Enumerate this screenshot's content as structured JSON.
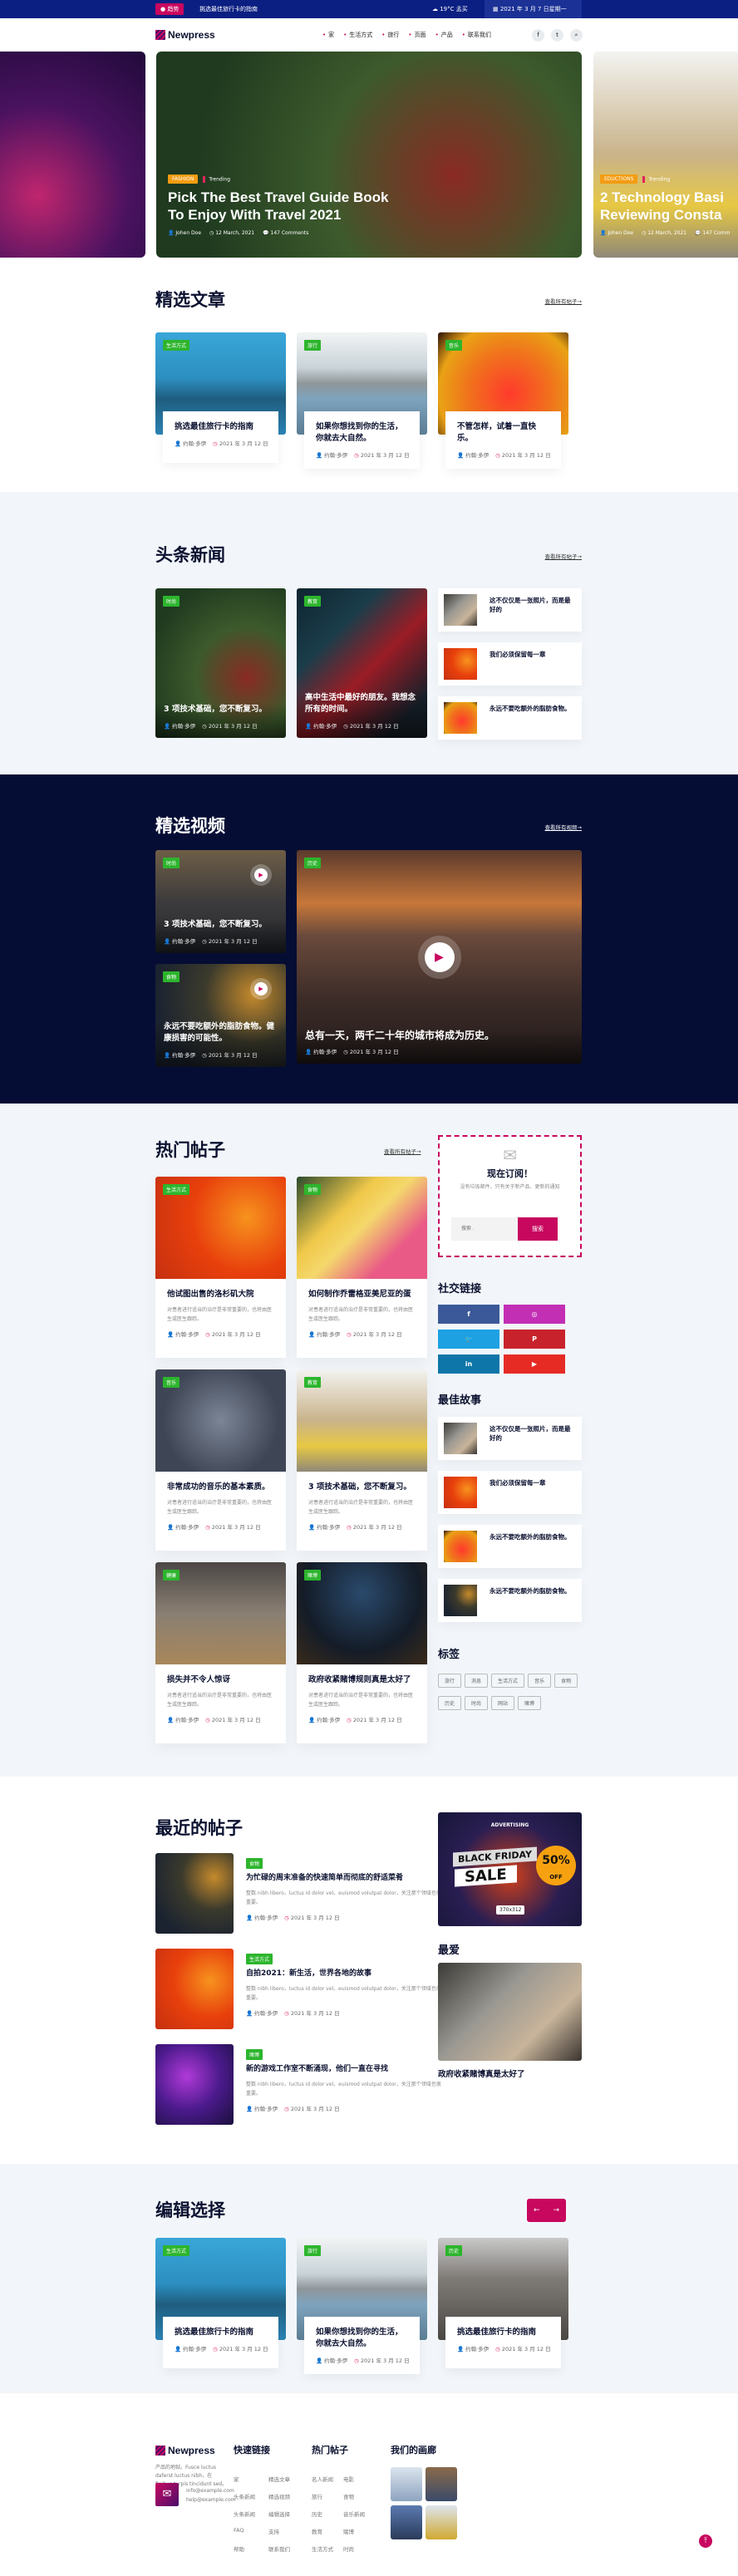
{
  "colors": {
    "accent": "#c8075f",
    "topbar": "#0b1f82",
    "tag_green": "#2db52d",
    "tag_orange": "#f39c12",
    "dark_section": "#050d35"
  },
  "topbar": {
    "badge": "● 趋势",
    "headline": "挑选最佳旅行卡的指南",
    "weather": "☁ 19°C 孟买",
    "date": "▦ 2021 年 3 月 7 日星期一"
  },
  "header": {
    "logo": "Newpress",
    "nav": [
      "家",
      "生活方式",
      "旅行",
      "页面",
      "产品",
      "联系我们"
    ],
    "social": [
      {
        "icon": "facebook-icon",
        "glyph": "f"
      },
      {
        "icon": "twitter-icon",
        "glyph": "t"
      },
      {
        "icon": "search-icon",
        "glyph": "⌕"
      }
    ]
  },
  "hero": {
    "slides": [
      {
        "tag": "FASHION",
        "trend": "Trending",
        "title1": "Pick The Best Travel Guide Book",
        "title2": "To Enjoy With Travel 2021",
        "author": "Johen Doe",
        "date": "12 March, 2021",
        "comments": "147 Comments"
      },
      {
        "tag": "EDUCTIONS",
        "trend": "Trending",
        "title1": "2 Technology Basi",
        "title2": "Reviewing Consta",
        "author": "Johen Doe",
        "date": "12 March, 2021",
        "comments": "147 Comm"
      }
    ]
  },
  "featured": {
    "title": "精选文章",
    "link": "查看所有帖子→",
    "cards": [
      {
        "tag": "生活方式",
        "title": "挑选最佳旅行卡的指南",
        "author": "约翰·多伊",
        "date": "2021 年 3 月 12 日",
        "img": "img-pier"
      },
      {
        "tag": "旅行",
        "title": "如果你想找到你的生活，你就去大自然。",
        "author": "约翰·多伊",
        "date": "2021 年 3 月 12 日",
        "img": "img-island"
      },
      {
        "tag": "音乐",
        "title": "不管怎样，试着一直快乐。",
        "author": "约翰·多伊",
        "date": "2021 年 3 月 12 日",
        "img": "img-concert"
      }
    ]
  },
  "headlines": {
    "title": "头条新闻",
    "link": "查看所有帖子→",
    "cards": [
      {
        "tag": "时尚",
        "title": "3 项技术基础，您不断复习。",
        "author": "约翰·多伊",
        "date": "2021 年 3 月 12 日",
        "img": "img-palm"
      },
      {
        "tag": "教育",
        "title": "高中生活中最好的朋友。我想念所有的时间。",
        "author": "约翰·多伊",
        "date": "2021 年 3 月 12 日",
        "img": "img-grad"
      }
    ],
    "side": [
      {
        "title": "这不仅仅是一张照片，而是最好的",
        "date": "2021 年 3 月 12 日",
        "img": "img-workshop"
      },
      {
        "title": "我们必须保留每一章",
        "date": "2021 年 3 月 12 日",
        "img": "img-party"
      },
      {
        "title": "永远不要吃额外的脂肪食物。",
        "date": "2021 年 3 月 12 日",
        "img": "img-concert"
      }
    ]
  },
  "videos": {
    "title": "精选视频",
    "link": "查看所有视频→",
    "cards": [
      {
        "tag": "时尚",
        "title": "3 项技术基础，您不断复习。",
        "author": "约翰·多伊",
        "date": "2021 年 3 月 12 日",
        "img": "img-car"
      },
      {
        "tag": "食物",
        "title": "永远不要吃额外的脂肪食物。健康损害的可能性。",
        "author": "约翰·多伊",
        "date": "2021 年 3 月 12 日",
        "img": "img-food"
      },
      {
        "tag": "历史",
        "title": "总有一天，两千二十年的城市将成为历史。",
        "author": "约翰·多伊",
        "date": "2021 年 3 月 12 日",
        "img": "img-city"
      }
    ]
  },
  "hot": {
    "title": "热门帖子",
    "link": "查看所有帖子→",
    "excerpt": "对患者进行适当的治疗是非常重要的，也将由医生或医生跟踪。",
    "cards": [
      {
        "tag": "生活方式",
        "title": "他试图出售的洛杉矶大院",
        "author": "约翰·多伊",
        "date": "2021 年 3 月 12 日",
        "img": "img-party"
      },
      {
        "tag": "食物",
        "title": "如何制作乔雷格亚美尼亚的蛋",
        "author": "约翰·多伊",
        "date": "2021 年 3 月 12 日",
        "img": "img-banana"
      },
      {
        "tag": "音乐",
        "title": "非常成功的音乐的基本素质。",
        "author": "约翰·多伊",
        "date": "2021 年 3 月 12 日",
        "img": "img-dance"
      },
      {
        "tag": "教育",
        "title": "3 项技术基础，您不断复习。",
        "author": "约翰·多伊",
        "date": "2021 年 3 月 12 日",
        "img": "img-student"
      },
      {
        "tag": "健康",
        "title": "损失并不令人惊讶",
        "author": "约翰·多伊",
        "date": "2021 年 3 月 12 日",
        "img": "img-gym"
      },
      {
        "tag": "赌博",
        "title": "政府收紧赌博规则真是太好了",
        "author": "约翰·多伊",
        "date": "2021 年 3 月 12 日",
        "img": "img-studio"
      }
    ]
  },
  "subscribe": {
    "title": "现在订阅！",
    "text": "没有垃圾邮件，只有关于新产品、更新的通知",
    "placeholder": "搜索 .",
    "button": "搜索"
  },
  "social_links": {
    "title": "社交链接",
    "items": [
      {
        "icon": "facebook-icon",
        "glyph": "f",
        "color": "#3b5998"
      },
      {
        "icon": "instagram-icon",
        "glyph": "◎",
        "color": "#c22fb4"
      },
      {
        "icon": "twitter-icon",
        "glyph": "🐦",
        "color": "#1da1e2"
      },
      {
        "icon": "pinterest-icon",
        "glyph": "P",
        "color": "#c8232c"
      },
      {
        "icon": "linkedin-icon",
        "glyph": "in",
        "color": "#0e76a8"
      },
      {
        "icon": "youtube-icon",
        "glyph": "▶",
        "color": "#e62b25"
      }
    ]
  },
  "best_stories": {
    "title": "最佳故事",
    "items": [
      {
        "title": "这不仅仅是一张照片，而是最好的",
        "date": "2021 年 3 月 12 日",
        "img": "img-workshop"
      },
      {
        "title": "我们必须保留每一章",
        "date": "2021 年 3 月 12 日",
        "img": "img-party"
      },
      {
        "title": "永远不要吃额外的脂肪食物。",
        "date": "2021 年 3 月 12 日",
        "img": "img-concert"
      },
      {
        "title": "永远不要吃额外的脂肪食物。",
        "date": "2021 年 3 月 12 日",
        "img": "img-food"
      }
    ]
  },
  "tags": {
    "title": "标签",
    "items": [
      "旅行",
      "消息",
      "生活方式",
      "音乐",
      "食物",
      "历史",
      "时尚",
      "网站",
      "赌博"
    ]
  },
  "recent": {
    "title": "最近的帖子",
    "excerpt": "整数 nibh libero，luctus id dolor vel，euismod volutpat dolor，关注那个领域也很重要。",
    "items": [
      {
        "tag": "食物",
        "title": "为忙碌的周末准备的快速简单而彻底的舒适菜肴",
        "author": "约翰·多伊",
        "date": "2021 年 3 月 12 日",
        "img": "img-food"
      },
      {
        "tag": "生活方式",
        "title": "自拍2021：新生活，世界各地的故事",
        "author": "约翰·多伊",
        "date": "2021 年 3 月 12 日",
        "img": "img-party"
      },
      {
        "tag": "赌博",
        "title": "新的游戏工作室不断涌现，他们一直在寻找",
        "author": "约翰·多伊",
        "date": "2021 年 3 月 12 日",
        "img": "img-gaming"
      }
    ]
  },
  "ad": {
    "label": "ADVERTISING",
    "line1": "BLACK FRIDAY",
    "line2": "SALE",
    "discount": "50%",
    "off": "OFF",
    "size": "370x312"
  },
  "favorite": {
    "title": "最爱",
    "caption": "政府收紧赌博真是太好了"
  },
  "editors": {
    "title": "编辑选择",
    "prev": "←",
    "next": "→",
    "cards": [
      {
        "tag": "生活方式",
        "title": "挑选最佳旅行卡的指南",
        "author": "约翰·多伊",
        "date": "2021 年 3 月 12 日",
        "img": "img-pier"
      },
      {
        "tag": "旅行",
        "title": "如果你想找到你的生活，你就去大自然。",
        "author": "约翰·多伊",
        "date": "2021 年 3 月 12 日",
        "img": "img-island"
      },
      {
        "tag": "历史",
        "title": "挑选最佳旅行卡的指南",
        "author": "约翰·多伊",
        "date": "2021 年 3 月 12 日",
        "img": "img-bwcity"
      }
    ]
  },
  "footer": {
    "logo": "Newpress",
    "about": "产品的地狱。Fusce luctus daferst luctus nibh，在finibus turpis tincidunt sed。",
    "email1": "info@example.com",
    "email2": "help@example.com",
    "quick_title": "快速链接",
    "quick": [
      "家",
      "精选文章",
      "头条新闻",
      "精选视频",
      "头条新闻",
      "编辑选择",
      "FAQ",
      "支持",
      "帮助",
      "联系我们"
    ],
    "hot_title": "热门帖子",
    "hot": [
      "名人新闻",
      "电影",
      "旅行",
      "食物",
      "历史",
      "音乐新闻",
      "教育",
      "赌博",
      "生活方式",
      "时尚"
    ],
    "gallery_title": "我们的画廊",
    "back_to_top": "⤒"
  }
}
